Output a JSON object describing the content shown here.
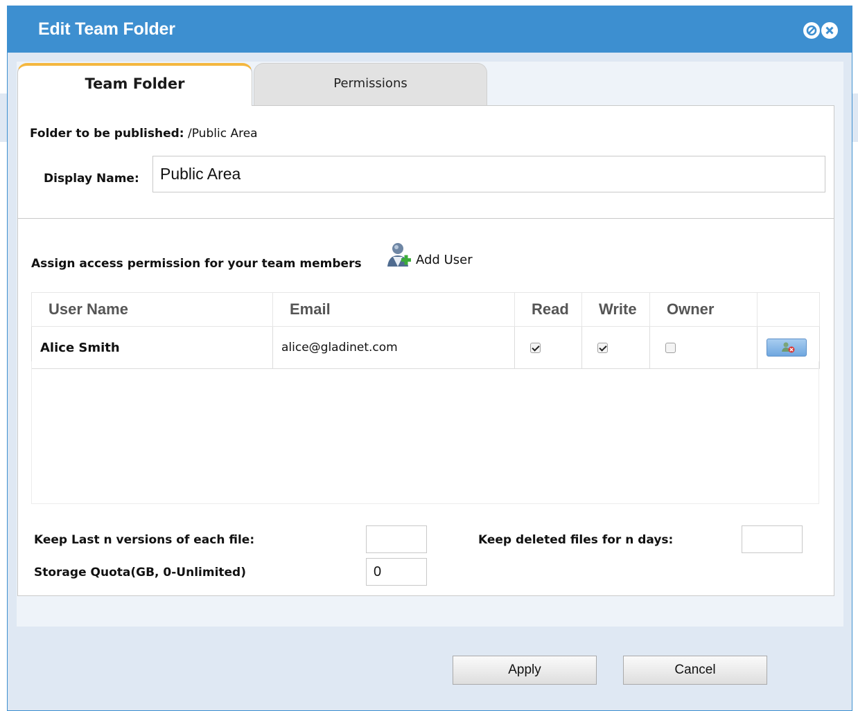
{
  "dialog": {
    "title": "Edit Team Folder",
    "minimize_icon": "minimize-circle-icon",
    "close_icon": "close-circle-icon"
  },
  "tabs": [
    {
      "label": "Team Folder",
      "active": true
    },
    {
      "label": "Permissions",
      "active": false
    }
  ],
  "folder": {
    "published_label": "Folder to be published:",
    "published_value": "/Public Area",
    "display_name_label": "Display Name:",
    "display_name_value": "Public Area"
  },
  "permissions": {
    "assign_label": "Assign access permission for your team members",
    "add_user_label": "Add User",
    "add_user_icon": "add-user-icon",
    "columns": [
      "User Name",
      "Email",
      "Read",
      "Write",
      "Owner",
      ""
    ],
    "rows": [
      {
        "user_name": "Alice Smith",
        "email": "alice@gladinet.com",
        "read": true,
        "write": true,
        "owner": false,
        "delete_icon": "remove-user-icon"
      }
    ]
  },
  "settings": {
    "keep_versions_label": "Keep Last n versions of each file:",
    "keep_versions_value": "",
    "keep_deleted_label": "Keep deleted files for n days:",
    "keep_deleted_value": "",
    "quota_label": "Storage Quota(GB, 0-Unlimited)",
    "quota_value": "0"
  },
  "buttons": {
    "apply": "Apply",
    "cancel": "Cancel"
  },
  "colors": {
    "titlebar": "#3d8fd0",
    "tab_accent": "#f4b73f",
    "dialog_bg": "#dfe8f3"
  }
}
